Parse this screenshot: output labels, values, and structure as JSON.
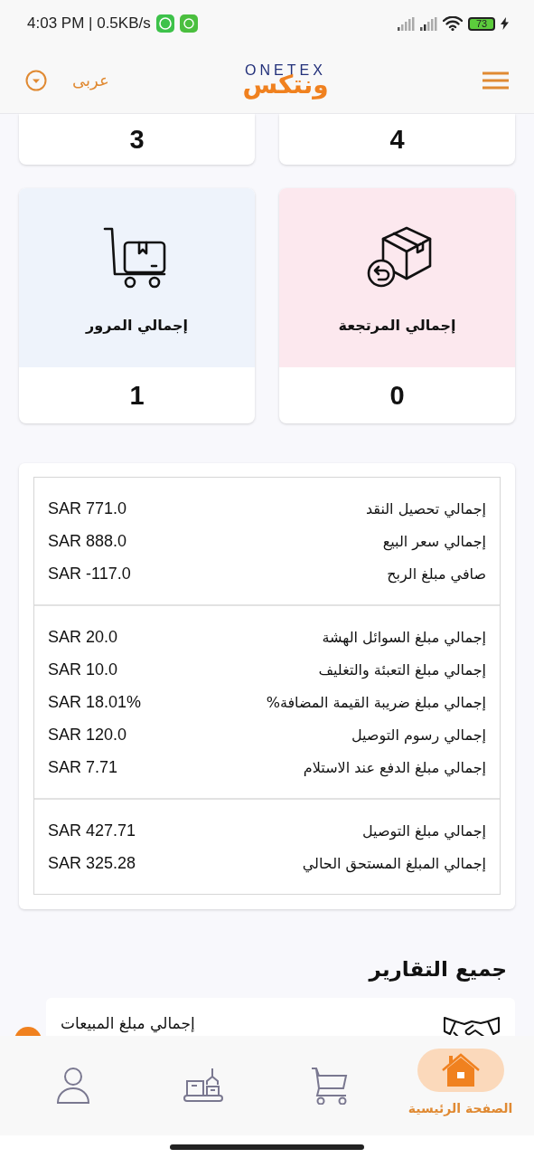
{
  "status_bar": {
    "time": "4:03 PM | 0.5KB/s",
    "battery": "73"
  },
  "header": {
    "language": "عربى",
    "logo": {
      "latin": "ONETEX",
      "arabic": "ونتكس"
    }
  },
  "top_cards": [
    {
      "value": "4"
    },
    {
      "value": "3"
    }
  ],
  "stat_cards": [
    {
      "kind": "return-box",
      "label": "إجمالي المرتجعة",
      "value": "0",
      "color": "#fce8ee"
    },
    {
      "kind": "trolley",
      "label": "إجمالي المرور",
      "value": "1",
      "color": "#eef3fb"
    }
  ],
  "summary_groups": [
    {
      "rows": [
        {
          "label": "إجمالي تحصيل النقد",
          "value": "SAR 771.0"
        },
        {
          "label": "إجمالي سعر البيع",
          "value": "SAR 888.0"
        },
        {
          "label": "صافي مبلغ الربح",
          "value": "SAR -117.0"
        }
      ]
    },
    {
      "rows": [
        {
          "label": "إجمالي مبلغ السوائل الهشة",
          "value": "SAR 20.0"
        },
        {
          "label": "إجمالي مبلغ التعبئة والتغليف",
          "value": "SAR 10.0"
        },
        {
          "label": "إجمالي مبلغ ضريبة القيمة المضافة%",
          "value": "SAR 18.01%"
        },
        {
          "label": "إجمالي رسوم التوصيل",
          "value": "SAR 120.0"
        },
        {
          "label": "إجمالي مبلغ الدفع عند الاستلام",
          "value": "SAR 7.71"
        }
      ]
    },
    {
      "rows": [
        {
          "label": "إجمالي مبلغ التوصيل",
          "value": "SAR 427.71"
        },
        {
          "label": "إجمالي المبلغ المستحق الحالي",
          "value": "SAR 325.28"
        }
      ]
    }
  ],
  "reports": {
    "title": "جميع التقارير",
    "items": [
      {
        "kind": "handshake",
        "label": "إجمالي مبلغ المبيعات"
      }
    ]
  },
  "bottom_nav": [
    {
      "kind": "home",
      "label": "الصفحة الرئيسية",
      "selected": true
    },
    {
      "kind": "cart",
      "selected": false
    },
    {
      "kind": "warehouse",
      "selected": false
    },
    {
      "kind": "user",
      "selected": false
    }
  ]
}
